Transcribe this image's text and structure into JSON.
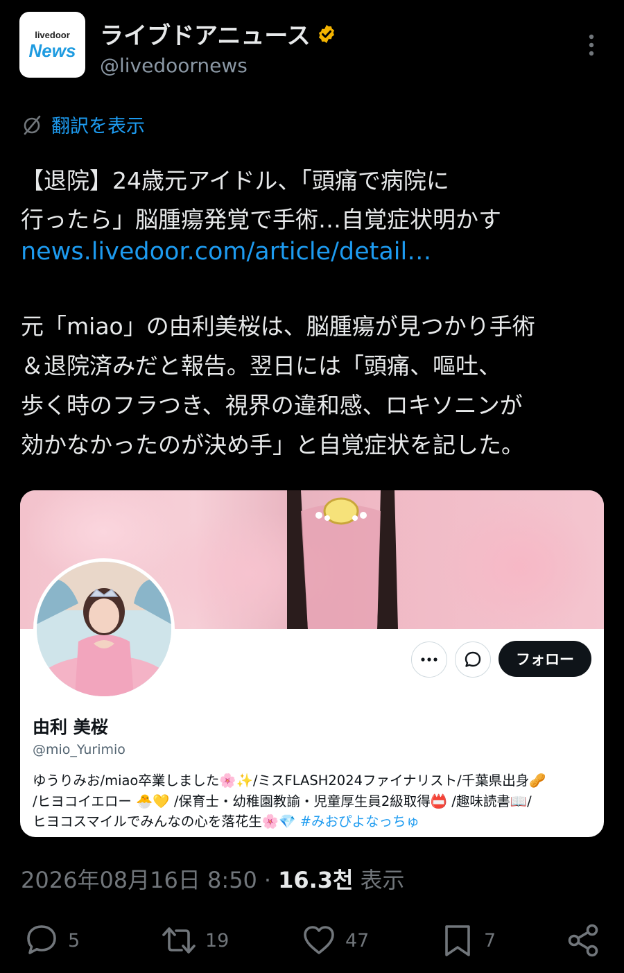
{
  "header": {
    "avatar_line1": "livedoor",
    "avatar_line2": "News",
    "display_name": "ライブドアニュース",
    "handle": "@livedoornews"
  },
  "translate": {
    "label": "翻訳を表示"
  },
  "tweet": {
    "headline_line1": "【退院】24歳元アイドル、「頭痛で病院に",
    "headline_line2": "行ったら」脳腫瘍発覚で手術…自覚症状明かす",
    "link": "news.livedoor.com/article/detail…",
    "body_line1": "元「miao」の由利美桜は、脳腫瘍が見つかり手術",
    "body_line2": "＆退院済みだと報告。翌日には「頭痛、嘔吐、",
    "body_line3": "歩く時のフラつき、視界の違和感、ロキソニンが",
    "body_line4": "効かなかったのが決め手」と自覚症状を記した。"
  },
  "card": {
    "follow_label": "フォロー",
    "name": "由利 美桜",
    "handle": "@mio_Yurimio",
    "bio_line1": "ゆうりみお/miao卒業しました🌸✨/ミスFLASH2024ファイナリスト/千葉県出身🥜",
    "bio_line2": "/ヒヨコイエロー 🐣💛 /保育士・幼稚園教諭・児童厚生員2級取得📛 /趣味読書📖/",
    "bio_line3": "ヒヨコスマイルでみんなの心を落花生🌸💎 ",
    "hashtag": "#みおぴよなっちゅ"
  },
  "meta": {
    "datetime": "2026年08月16日 8:50",
    "separator": "·",
    "views_count": "16.3천",
    "views_label": "表示"
  },
  "actions": {
    "reply_count": "5",
    "retweet_count": "19",
    "like_count": "47",
    "bookmark_count": "7"
  },
  "colors": {
    "background": "#000000",
    "text": "#e7e9ea",
    "muted": "#71767b",
    "link": "#1d9bf0",
    "verified_gold": "#f4b400"
  },
  "icons": [
    "verified-badge-icon",
    "more-icon",
    "translate-icon",
    "card-more-icon",
    "message-icon",
    "reply-icon",
    "retweet-icon",
    "like-icon",
    "bookmark-icon",
    "share-icon"
  ]
}
